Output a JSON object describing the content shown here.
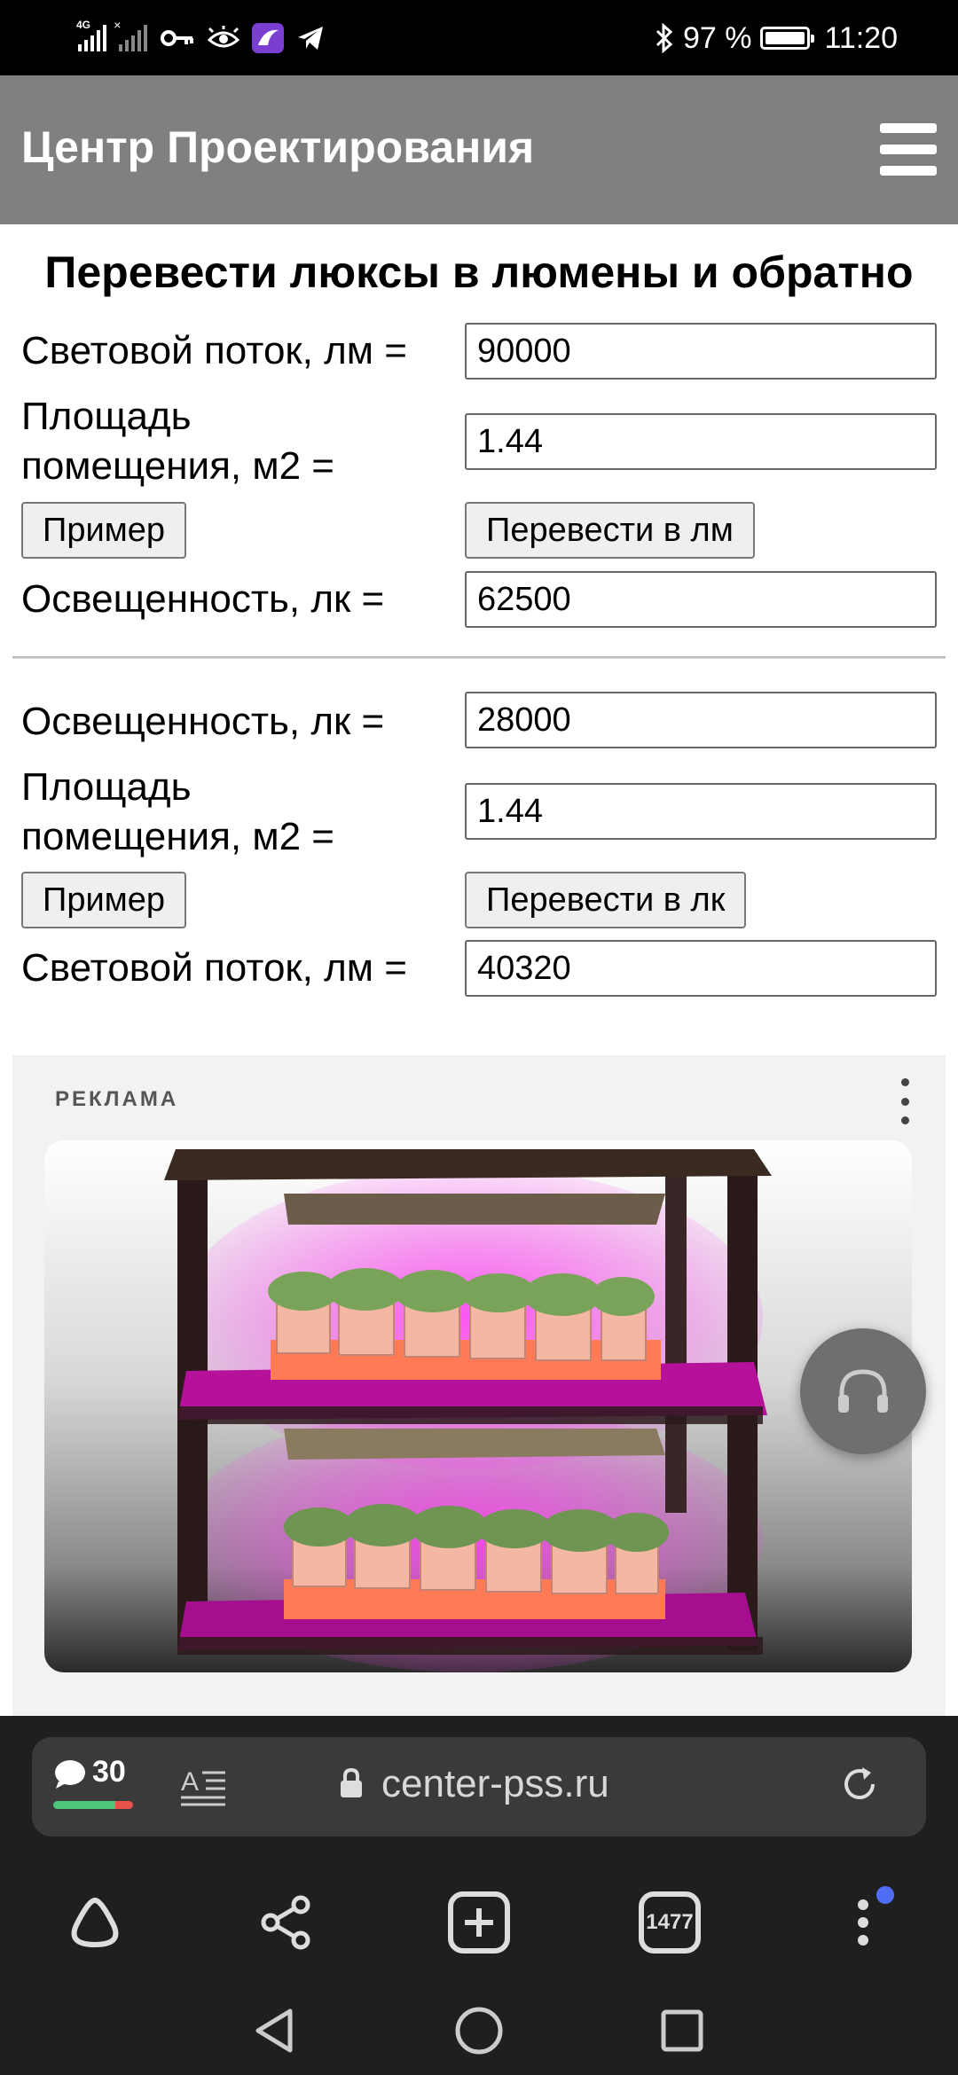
{
  "status_bar": {
    "network": "4G",
    "battery": "97 %",
    "time": "11:20",
    "icons": [
      "signal-icon",
      "signal-no-sim-icon",
      "vpn-key-icon",
      "eye-icon",
      "app-icon",
      "telegram-icon",
      "bluetooth-icon",
      "battery-icon"
    ]
  },
  "header": {
    "site_title": "Центр Проектирования",
    "menu_icon": "hamburger-menu-icon"
  },
  "converter": {
    "title": "Перевести люксы в люмены и обратно",
    "section1": {
      "flux_label": "Световой поток, лм =",
      "flux_value": "90000",
      "area_label_line1": "Площадь",
      "area_label_line2": "помещения, м2 =",
      "area_value": "1.44",
      "example_button": "Пример",
      "convert_button": "Перевести в лм",
      "illuminance_label": "Освещенность, лк =",
      "illuminance_value": "62500"
    },
    "section2": {
      "illuminance_label": "Освещенность, лк =",
      "illuminance_value": "28000",
      "area_label_line1": "Площадь",
      "area_label_line2": "помещения, м2 =",
      "area_value": "1.44",
      "example_button": "Пример",
      "convert_button": "Перевести в лк",
      "flux_label": "Световой поток, лм =",
      "flux_value": "40320"
    }
  },
  "ad": {
    "label": "РЕКЛАМА",
    "image_subject": "plant-shelf-grow-light-image"
  },
  "browser": {
    "comments_count": "30",
    "url": "center-pss.ru",
    "tabs_count": "1477"
  },
  "colors": {
    "header_bg": "#808080",
    "status_bg": "#000000",
    "browser_bg": "#1f1f1f",
    "url_pill_bg": "#3a3a3a",
    "accent_dot": "#4f6df5",
    "comments_green": "#4cc77a",
    "comments_red": "#e5544a"
  }
}
